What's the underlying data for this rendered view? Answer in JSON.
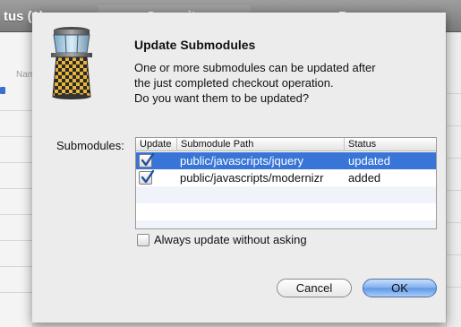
{
  "background": {
    "tabs": [
      "tus (1)",
      "Commits",
      "Browse"
    ],
    "column_label": "Name"
  },
  "dialog": {
    "title": "Update Submodules",
    "message": [
      "One or more submodules can be updated after",
      "the just completed checkout operation.",
      "Do you want them to be updated?"
    ],
    "submodules_label": "Submodules:",
    "table": {
      "headers": [
        "Update",
        "Submodule Path",
        "Status"
      ],
      "rows": [
        {
          "checked": true,
          "path": "public/javascripts/jquery",
          "status": "updated",
          "selected": true
        },
        {
          "checked": true,
          "path": "public/javascripts/modernizr",
          "status": "added",
          "selected": false
        }
      ]
    },
    "always_update": {
      "checked": false,
      "label": "Always update without asking"
    },
    "buttons": {
      "cancel": "Cancel",
      "ok": "OK"
    }
  },
  "colors": {
    "selection": "#3875d7",
    "check_mark": "#1f4f9e",
    "default_button": "#5e97e6"
  },
  "icons": [
    "tower-app-icon",
    "checkmark-icon"
  ]
}
